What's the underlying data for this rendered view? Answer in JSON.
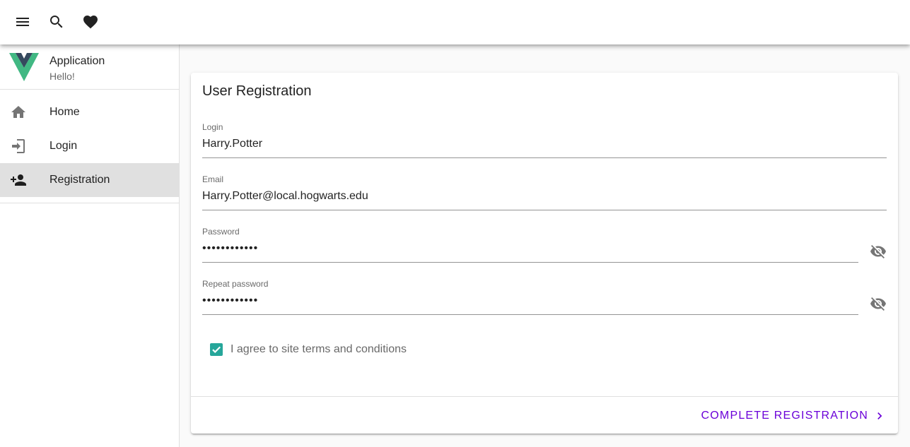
{
  "toolbar": {
    "menu_icon": "menu-icon",
    "search_icon": "search-icon",
    "favorite_icon": "heart-icon"
  },
  "drawer": {
    "app_title": "Application",
    "app_subtitle": "Hello!",
    "logo_icon": "vue-logo",
    "items": [
      {
        "label": "Home",
        "icon": "home-icon",
        "active": false
      },
      {
        "label": "Login",
        "icon": "login-icon",
        "active": false
      },
      {
        "label": "Registration",
        "icon": "person-add-icon",
        "active": true
      }
    ]
  },
  "form": {
    "title": "User Registration",
    "login": {
      "label": "Login",
      "value": "Harry.Potter"
    },
    "email": {
      "label": "Email",
      "value": "Harry.Potter@local.hogwarts.edu"
    },
    "password": {
      "label": "Password",
      "value": "••••••••••••",
      "icon": "eye-off-icon"
    },
    "repeat_password": {
      "label": "Repeat password",
      "value": "••••••••••••",
      "icon": "eye-off-icon"
    },
    "agree": {
      "label": "I agree to site terms and conditions",
      "checked": true
    },
    "submit_label": "Complete Registration"
  },
  "colors": {
    "accent": "#6a00d8",
    "checkbox": "#26a69a",
    "logo_green": "#41b883",
    "logo_dark": "#35495e"
  }
}
